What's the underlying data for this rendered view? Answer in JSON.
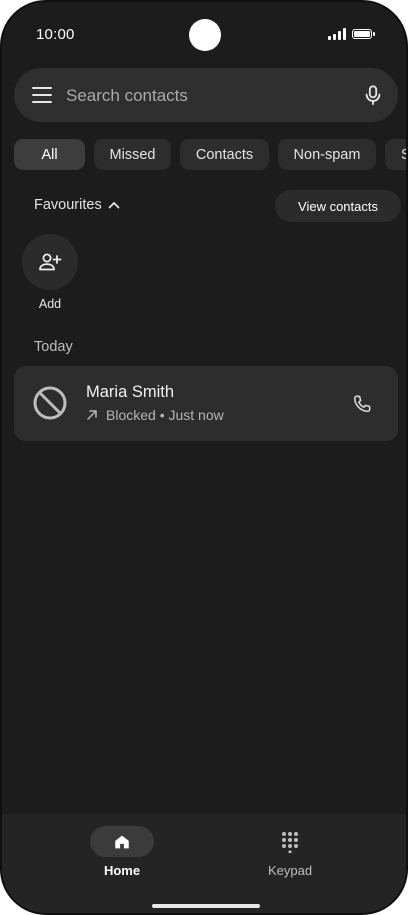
{
  "status_bar": {
    "time": "10:00",
    "icons": [
      "signal-icon",
      "battery-icon"
    ]
  },
  "search": {
    "placeholder": "Search contacts",
    "value": "",
    "menu_icon": "menu-icon",
    "mic_icon": "mic-icon"
  },
  "filters": {
    "chips": [
      {
        "label": "All",
        "selected": true
      },
      {
        "label": "Missed",
        "selected": false
      },
      {
        "label": "Contacts",
        "selected": false
      },
      {
        "label": "Non-spam",
        "selected": false
      },
      {
        "label": "S",
        "selected": false
      }
    ]
  },
  "favourites": {
    "header": "Favourites",
    "expanded": true,
    "view_contacts_label": "View contacts",
    "add_label": "Add"
  },
  "recents": {
    "section_label": "Today",
    "calls": [
      {
        "name": "Maria Smith",
        "status": "Blocked • Just now",
        "direction": "outgoing",
        "avatar_icon": "blocked-icon",
        "action_icon": "phone-icon"
      }
    ]
  },
  "bottom_nav": {
    "items": [
      {
        "label": "Home",
        "icon": "home-icon",
        "selected": true
      },
      {
        "label": "Keypad",
        "icon": "dialpad-icon",
        "selected": false
      }
    ]
  },
  "colors": {
    "background": "#1b1c1b",
    "surface": "#2c2d2c",
    "text_primary": "#f1f1f1",
    "text_secondary": "#b5b5b5"
  }
}
